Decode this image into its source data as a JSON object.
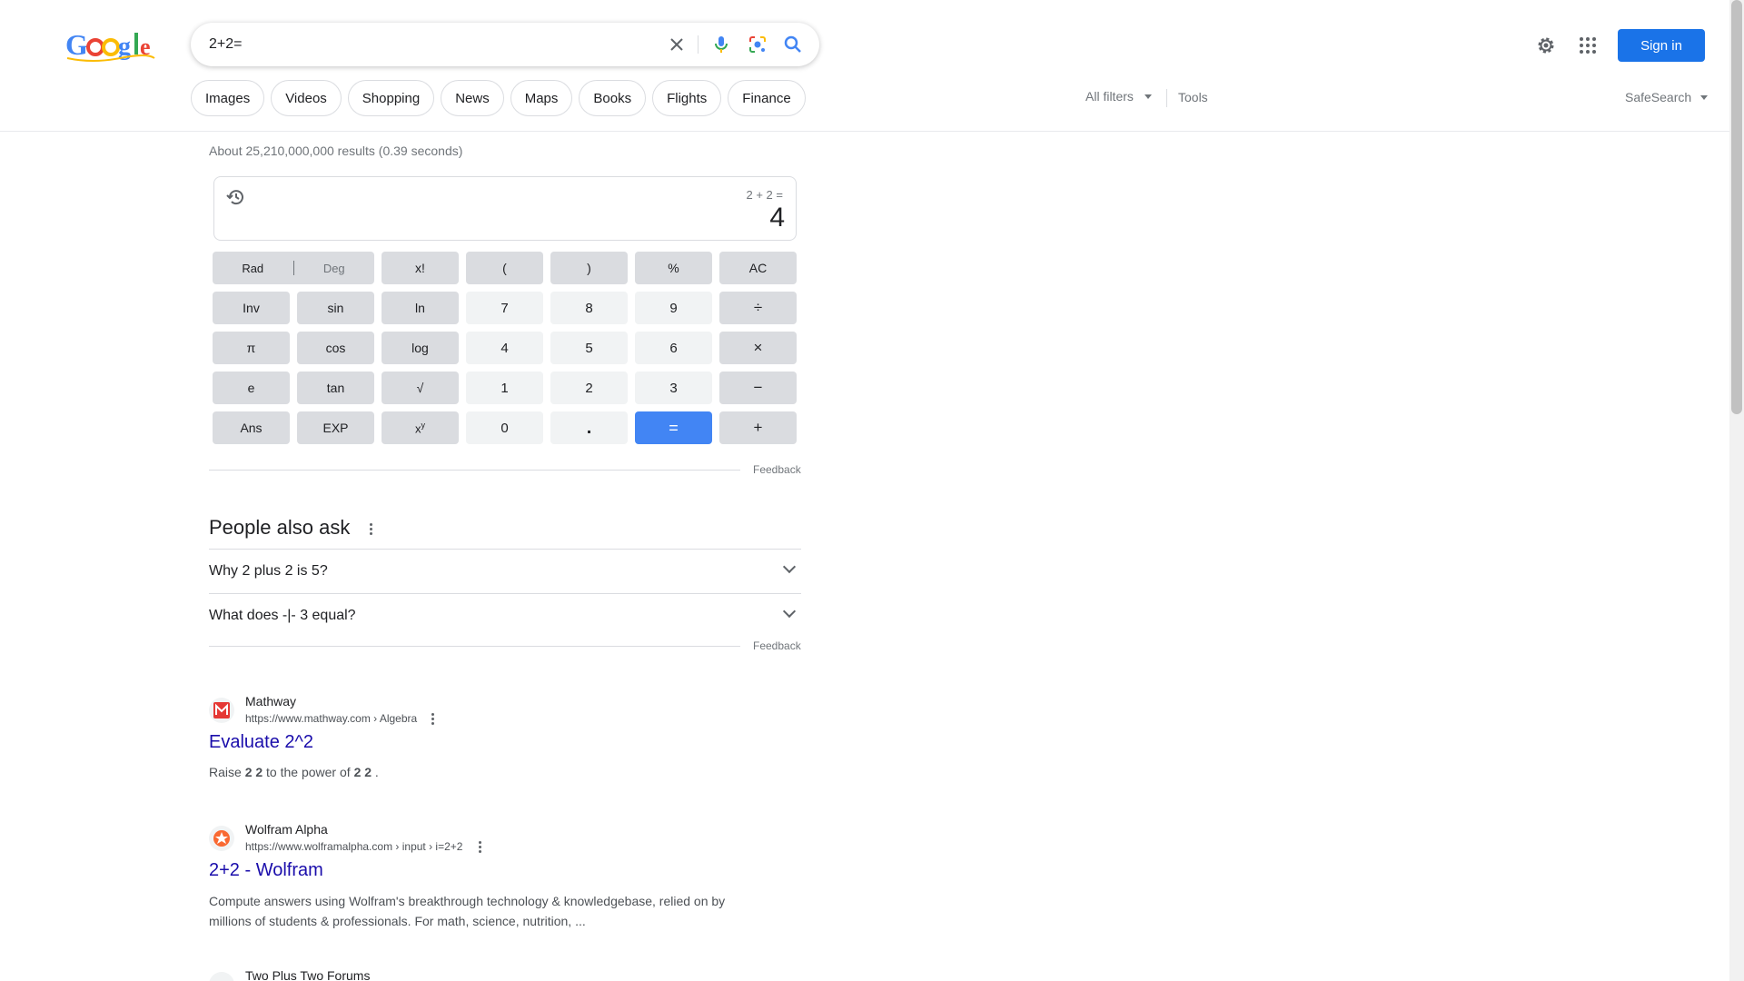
{
  "search": {
    "query": "2+2="
  },
  "header": {
    "signin_label": "Sign in"
  },
  "chips": [
    "Images",
    "Videos",
    "Shopping",
    "News",
    "Maps",
    "Books",
    "Flights",
    "Finance"
  ],
  "filters": {
    "all_filters": "All filters",
    "tools": "Tools",
    "safesearch": "SafeSearch"
  },
  "stats": "About 25,210,000,000 results (0.39 seconds)",
  "calculator": {
    "expression": "2 + 2 =",
    "result": "4",
    "rad": "Rad",
    "deg": "Deg",
    "keys": {
      "fact": "x!",
      "lparen": "(",
      "rparen": ")",
      "percent": "%",
      "ac": "AC",
      "inv": "Inv",
      "sin": "sin",
      "ln": "ln",
      "seven": "7",
      "eight": "8",
      "nine": "9",
      "divide": "÷",
      "pi": "π",
      "cos": "cos",
      "log": "log",
      "four": "4",
      "five": "5",
      "six": "6",
      "multiply": "×",
      "e": "e",
      "tan": "tan",
      "sqrt": "√",
      "one": "1",
      "two": "2",
      "three": "3",
      "minus": "−",
      "ans": "Ans",
      "exp": "EXP",
      "zero": "0",
      "dot": ".",
      "equals": "=",
      "plus": "+"
    },
    "feedback": "Feedback"
  },
  "people_also_ask": {
    "title": "People also ask",
    "questions": [
      "Why 2 plus 2 is 5?",
      "What does -|- 3 equal?"
    ],
    "feedback": "Feedback"
  },
  "results": [
    {
      "site": "Mathway",
      "url": "https://www.mathway.com › Algebra",
      "title": "Evaluate 2^2",
      "snippet_pre": "Raise ",
      "snippet_b1": "2 2",
      "snippet_mid": " to the power of ",
      "snippet_b2": "2 2",
      "snippet_post": " ."
    },
    {
      "site": "Wolfram Alpha",
      "url": "https://www.wolframalpha.com › input › i=2+2",
      "title": "2+2 - Wolfram",
      "snippet": "Compute answers using Wolfram's breakthrough technology & knowledgebase, relied on by millions of students & professionals. For math, science, nutrition, ..."
    },
    {
      "site": "Two Plus Two Forums"
    }
  ]
}
